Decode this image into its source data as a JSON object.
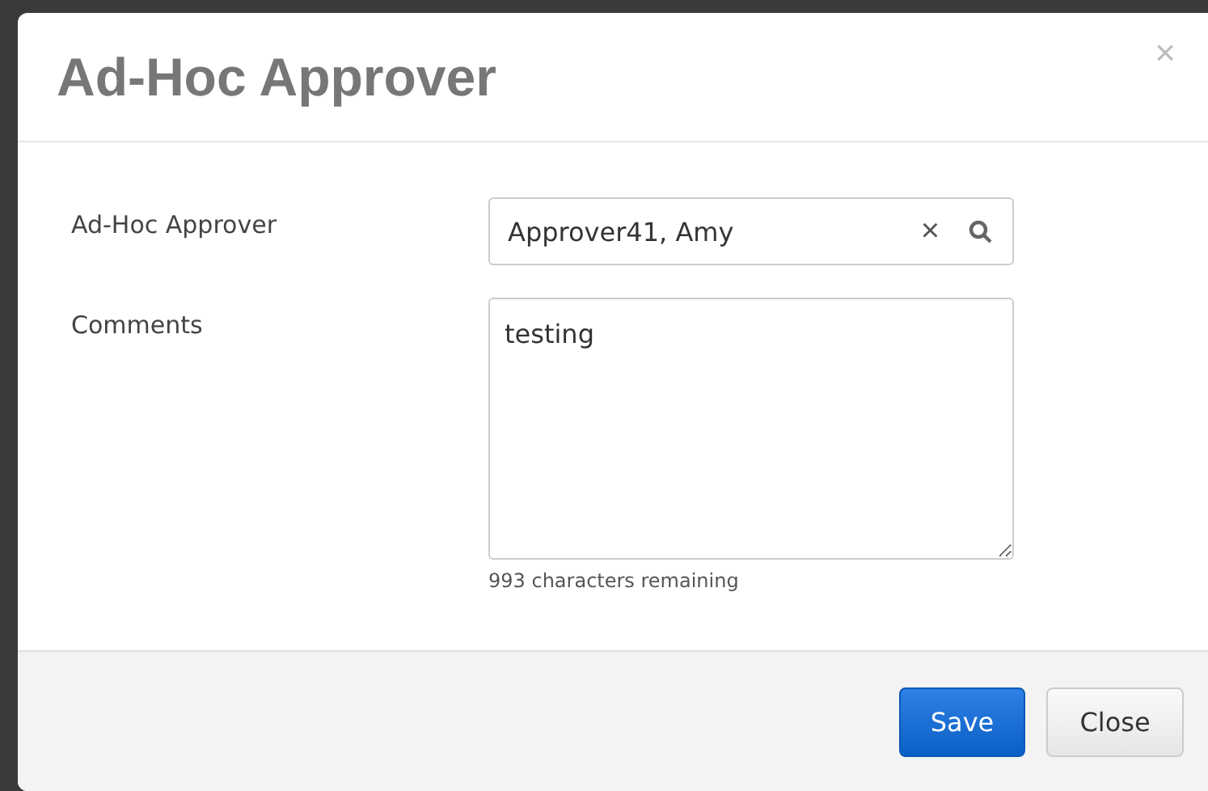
{
  "dialog": {
    "title": "Ad-Hoc Approver",
    "close_glyph": "×"
  },
  "fields": [
    {
      "kind": "lookup",
      "label": "Ad-Hoc Approver",
      "value": "Approver41, Amy",
      "clear_glyph": "×"
    },
    {
      "kind": "textarea",
      "label": "Comments",
      "value": "testing",
      "hint": "993 characters remaining"
    }
  ],
  "buttons": [
    {
      "label": "Save",
      "kind": "primary"
    },
    {
      "label": "Close",
      "kind": "default"
    }
  ]
}
